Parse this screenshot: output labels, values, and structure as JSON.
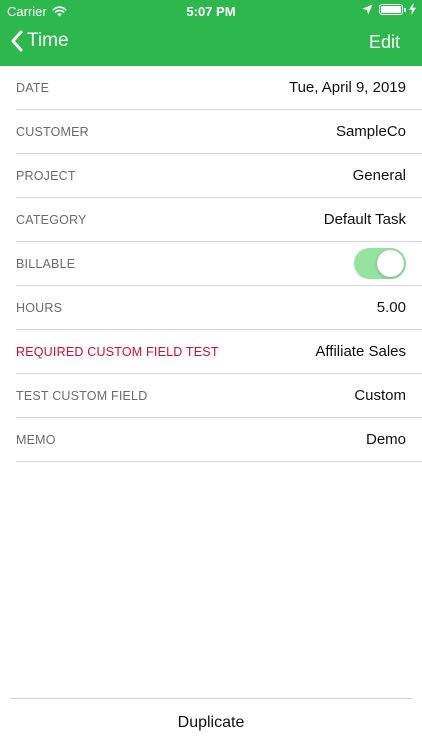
{
  "status_bar": {
    "carrier": "Carrier",
    "time": "5:07 PM"
  },
  "nav": {
    "back_label": "Time",
    "edit_label": "Edit"
  },
  "fields": [
    {
      "label": "DATE",
      "value": "Tue, April 9, 2019"
    },
    {
      "label": "CUSTOMER",
      "value": "SampleCo"
    },
    {
      "label": "PROJECT",
      "value": "General"
    },
    {
      "label": "CATEGORY",
      "value": "Default Task"
    },
    {
      "label": "BILLABLE",
      "value": null
    },
    {
      "label": "HOURS",
      "value": "5.00"
    },
    {
      "label": "REQUIRED CUSTOM FIELD TEST",
      "value": "Affiliate Sales"
    },
    {
      "label": "TEST CUSTOM FIELD",
      "value": "Custom"
    },
    {
      "label": "MEMO",
      "value": "Demo"
    }
  ],
  "billable_on": true,
  "colors": {
    "nav_green": "#2db84d",
    "required_red": "#c8102e",
    "toggle_on": "#94e39f"
  },
  "footer": {
    "duplicate_label": "Duplicate"
  }
}
